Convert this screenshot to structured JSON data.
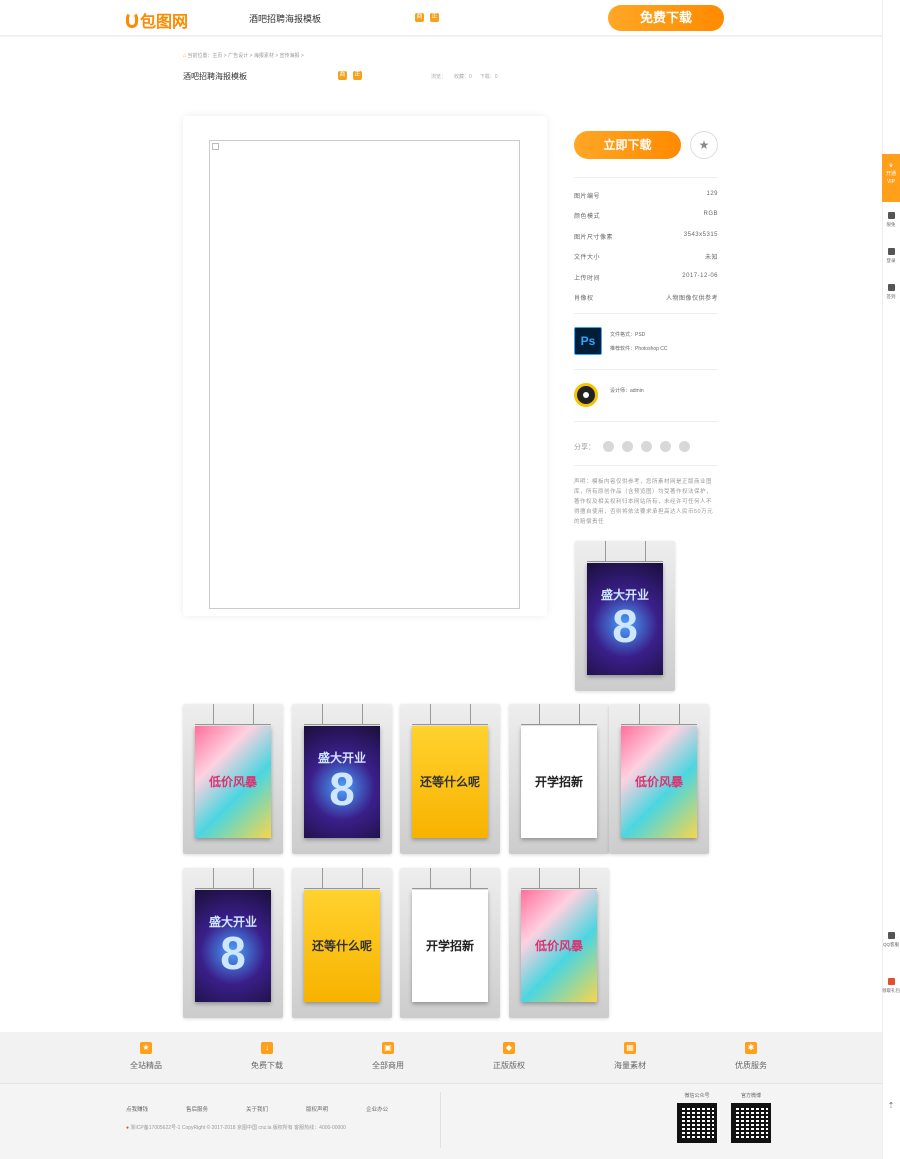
{
  "header": {
    "logo_text": "包图网",
    "title": "酒吧招聘海报模板",
    "download_label": "免费下载"
  },
  "breadcrumb": {
    "text": "当前位置：主页 > 广告设计 > 海报素材 > 宣传海报 >"
  },
  "page": {
    "title": "酒吧招聘海报模板",
    "stats": [
      "浏览：",
      "收藏：0",
      "下载：0"
    ]
  },
  "sidebar": {
    "download_label": "立即下载",
    "fav_icon": "star-icon",
    "info": [
      {
        "label": "图片编号",
        "value": "129"
      },
      {
        "label": "颜色模式",
        "value": "RGB"
      },
      {
        "label": "图片尺寸像素",
        "value": "3543x5315"
      },
      {
        "label": "文件大小",
        "value": "未知"
      },
      {
        "label": "上传时间",
        "value": "2017-12-06"
      },
      {
        "label": "肖像权",
        "value": "人物图像仅供参考"
      }
    ],
    "file_format": "文件格式：PSD",
    "software": "推荐软件：Photoshop CC",
    "ps_label": "Ps",
    "designer": "设计师：admin",
    "share_label": "分享：",
    "disclaimer": "声明：模板内容仅供参考，您所素材网是正版商业图库，所有原创作品（含预览图）均受著作权法保护，著作权及相关权利归本网站所有，未经许可任何人不得擅自使用，否则将依法要求承担高达人民币50万元的赔偿责任"
  },
  "thumbnails": [
    {
      "style": "dark",
      "text": "盛大开业",
      "big": "8"
    },
    {
      "style": "pink",
      "text": "低价风暴",
      "big": ""
    },
    {
      "style": "dark",
      "text": "盛大开业",
      "big": "8"
    },
    {
      "style": "yellow",
      "text": "还等什么呢",
      "big": ""
    },
    {
      "style": "white",
      "text": "开学招新",
      "big": ""
    },
    {
      "style": "pink",
      "text": "低价风暴",
      "big": ""
    },
    {
      "style": "dark",
      "text": "盛大开业",
      "big": "8"
    },
    {
      "style": "yellow",
      "text": "还等什么呢",
      "big": ""
    },
    {
      "style": "white",
      "text": "开学招新",
      "big": ""
    },
    {
      "style": "pink",
      "text": "低价风暴",
      "big": ""
    }
  ],
  "services": [
    {
      "label": "全站精品",
      "icon": "star-icon"
    },
    {
      "label": "免费下载",
      "icon": "download-icon"
    },
    {
      "label": "全部商用",
      "icon": "briefcase-icon"
    },
    {
      "label": "正版版权",
      "icon": "shield-icon"
    },
    {
      "label": "海量素材",
      "icon": "grid-icon"
    },
    {
      "label": "优质服务",
      "icon": "gear-icon"
    }
  ],
  "footer": {
    "links": [
      "点我赚钱",
      "售后服务",
      "关于我们",
      "版权声明",
      "企业办公"
    ],
    "copyright": "浙ICP备17005622号-1    CopyRight © 2017-2018 京图中国 cnz.la 版权所有 客服热线：4000-00000",
    "qr_labels": [
      "微信公众号",
      "官方微博"
    ]
  },
  "rail": {
    "vip": [
      "开通",
      "VIP"
    ],
    "items": [
      "限免",
      "登录",
      "签到",
      "QQ客服",
      "领取礼包"
    ]
  },
  "colors": {
    "accent": "#ff8a00",
    "accent_light": "#ffa726"
  }
}
